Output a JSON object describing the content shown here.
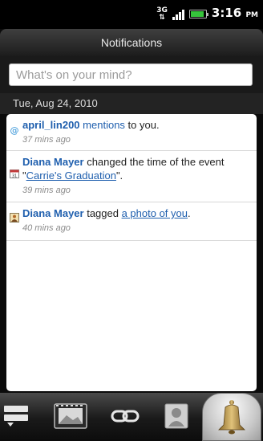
{
  "status_bar": {
    "network": "3G",
    "time": "3:16",
    "ampm": "PM"
  },
  "header": {
    "title": "Notifications"
  },
  "compose": {
    "placeholder": "What's on your mind?"
  },
  "date_header": "Tue, Aug 24, 2010",
  "notifications": [
    {
      "icon": "mention-icon",
      "user": "april_lin200",
      "action_link": "mentions",
      "rest": " to you.",
      "time": "37 mins ago"
    },
    {
      "icon": "calendar-icon",
      "user": "Diana Mayer",
      "text_before": " changed the time of the event \"",
      "event_link": "Carrie's Graduation",
      "text_after": "\".",
      "time": "39 mins ago"
    },
    {
      "icon": "photo-icon",
      "user": "Diana Mayer",
      "text_before": " tagged ",
      "photo_link": "a photo of you",
      "text_after": ".",
      "time": "40 mins ago"
    }
  ],
  "tabs": [
    {
      "icon": "status-updates-icon"
    },
    {
      "icon": "photos-icon"
    },
    {
      "icon": "links-icon"
    },
    {
      "icon": "profile-icon"
    },
    {
      "icon": "notifications-bell-icon",
      "active": true
    }
  ],
  "colors": {
    "link": "#1f5fae",
    "accent_green": "#36c43b"
  }
}
